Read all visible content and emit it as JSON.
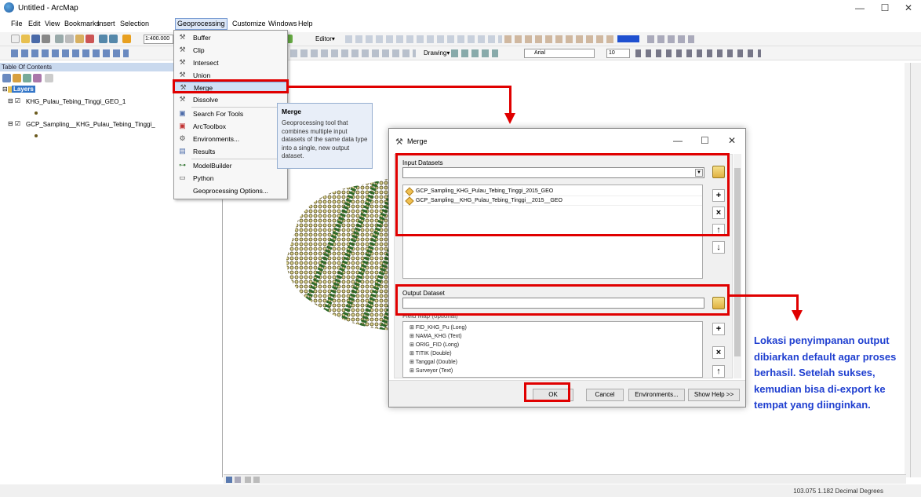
{
  "window": {
    "title": "Untitled - ArcMap",
    "minimize": "—",
    "maximize": "☐",
    "close": "✕"
  },
  "menubar": [
    "File",
    "Edit",
    "View",
    "Bookmarks",
    "Insert",
    "Selection",
    "Geoprocessing",
    "Customize",
    "Windows",
    "Help"
  ],
  "toolbar": {
    "scale": "1:400.000",
    "editor": "Editor▾",
    "drawing": "Drawing▾",
    "font": "Arial",
    "font_size": "10"
  },
  "toc": {
    "header": "Table Of Contents",
    "root": "Layers",
    "layers": [
      "KHG_Pulau_Tebing_Tinggi_GEO_1",
      "GCP_Sampling__KHG_Pulau_Tebing_Tinggi_"
    ]
  },
  "geoprocessing_menu": {
    "items": [
      "Buffer",
      "Clip",
      "Intersect",
      "Union",
      "Merge",
      "Dissolve",
      "Search For Tools",
      "ArcToolbox",
      "Environments...",
      "Results",
      "ModelBuilder",
      "Python",
      "Geoprocessing Options..."
    ],
    "highlighted": "Merge"
  },
  "tooltip": {
    "title": "Merge",
    "body": "Geoprocessing tool that combines multiple input datasets of the same data type into a single, new output dataset."
  },
  "dialog": {
    "title": "Merge",
    "input_label": "Input Datasets",
    "input_datasets": [
      "GCP_Sampling_KHG_Pulau_Tebing_Tinggi_2015_GEO",
      "GCP_Sampling__KHG_Pulau_Tebing_Tinggi__2015__GEO"
    ],
    "output_label": "Output Dataset",
    "output_value": "",
    "field_map_label": "Field Map (optional)",
    "field_map": [
      "FID_KHG_Pu (Long)",
      "NAMA_KHG (Text)",
      "ORIG_FID (Long)",
      "TITIK (Double)",
      "Tanggal (Double)",
      "Surveyor (Text)"
    ],
    "buttons": {
      "ok": "OK",
      "cancel": "Cancel",
      "environments": "Environments...",
      "help": "Show Help >>"
    }
  },
  "annotation": {
    "text": "Lokasi penyimpanan output dibiarkan default agar proses berhasil. Setelah sukses, kemudian bisa di-export ke tempat yang diinginkan.",
    "color": "#1f3fd0",
    "highlight_color": "#e00000"
  },
  "status": {
    "coords": "103.075  1.182 Decimal Degrees"
  }
}
